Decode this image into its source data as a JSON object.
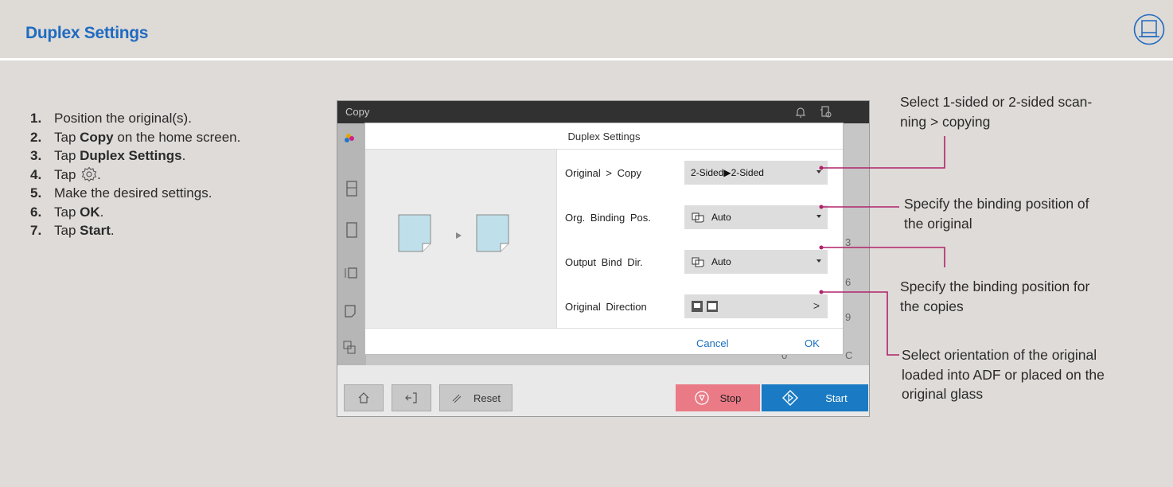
{
  "header": {
    "title": "Duplex Settings",
    "icon": "book-icon"
  },
  "steps": [
    {
      "num": "1.",
      "parts": [
        {
          "t": "Position the original(s).",
          "b": false
        }
      ]
    },
    {
      "num": "2.",
      "parts": [
        {
          "t": "Tap ",
          "b": false
        },
        {
          "t": "Copy",
          "b": true
        },
        {
          "t": " on the home screen.",
          "b": false
        }
      ]
    },
    {
      "num": "3.",
      "parts": [
        {
          "t": "Tap ",
          "b": false
        },
        {
          "t": "Duplex Settings",
          "b": true
        },
        {
          "t": ".",
          "b": false
        }
      ]
    },
    {
      "num": "4.",
      "parts": [
        {
          "t": "Tap ",
          "b": false
        },
        {
          "t": "[gear-icon]",
          "b": false
        },
        {
          "t": ".",
          "b": false
        }
      ]
    },
    {
      "num": "5.",
      "parts": [
        {
          "t": "Make the desired settings.",
          "b": false
        }
      ]
    },
    {
      "num": "6.",
      "parts": [
        {
          "t": "Tap ",
          "b": false
        },
        {
          "t": "OK",
          "b": true
        },
        {
          "t": ".",
          "b": false
        }
      ]
    },
    {
      "num": "7.",
      "parts": [
        {
          "t": "Tap ",
          "b": false
        },
        {
          "t": "Start",
          "b": true
        },
        {
          "t": ".",
          "b": false
        }
      ]
    }
  ],
  "device": {
    "title": "Copy",
    "keys": [
      "3",
      "6",
      "9",
      "0",
      "C"
    ],
    "bottom": {
      "reset": "Reset",
      "stop": "Stop",
      "start": "Start"
    }
  },
  "dialog": {
    "title": "Duplex Settings",
    "rows": [
      {
        "label": "Original > Copy",
        "value": "2-Sided▶2-Sided",
        "control": "dropdown"
      },
      {
        "label": "Org. Binding Pos.",
        "value": "Auto",
        "control": "dropdown"
      },
      {
        "label": "Output Bind Dir.",
        "value": "Auto",
        "control": "dropdown"
      },
      {
        "label": "Original Direction",
        "value": "",
        "control": "chevron"
      }
    ],
    "cancel": "Cancel",
    "ok": "OK"
  },
  "callouts": [
    {
      "lines": [
        "Select 1-sided or 2-sided scan-",
        "ning > copying"
      ]
    },
    {
      "lines": [
        "Specify the binding position of",
        "the original"
      ]
    },
    {
      "lines": [
        "Specify the binding position for",
        "the copies"
      ]
    },
    {
      "lines": [
        "Select orientation of the original",
        "loaded into ADF or placed on the",
        "original glass"
      ]
    }
  ],
  "colors": {
    "accent": "#1f6bc0",
    "callout_line": "#b0236a",
    "stop": "#e97a86",
    "start": "#1a7bc4"
  }
}
